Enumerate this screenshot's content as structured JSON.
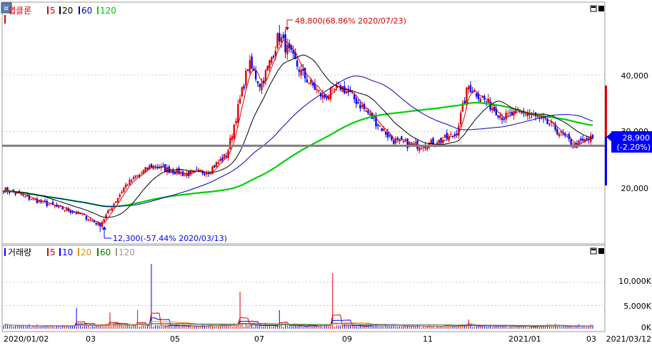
{
  "price_panel": {
    "legend": {
      "name": "앱클론",
      "ma_labels": [
        "5",
        "20",
        "60",
        "120"
      ]
    },
    "high_annotation": "48,800(68.86% 2020/07/23)",
    "low_annotation": "12,300(-57.44% 2020/03/13)",
    "current_price": "28,900",
    "current_change": "(-2.20%)",
    "y_labels": [
      "40,000",
      "30,000",
      "20,000"
    ]
  },
  "volume_panel": {
    "legend": {
      "name": "거래량",
      "ma_labels": [
        "5",
        "10",
        "20",
        "60",
        "120"
      ]
    },
    "y_labels": [
      "10,000K",
      "5,000K",
      "0K"
    ]
  },
  "x_labels": [
    "2020/01/02",
    "03",
    "05",
    "07",
    "09",
    "11",
    "2021/01",
    "03",
    "2021/03/12"
  ],
  "colors": {
    "up": "#e00000",
    "down": "#0000ff",
    "ma5": "#e00000",
    "ma20": "#000000",
    "ma60": "#0000c0",
    "ma120": "#00d000",
    "reference_line": "#808080",
    "grid": "#c8c8c8"
  },
  "chart_data": [
    {
      "type": "candlestick",
      "title": "앱클론",
      "x_range": [
        "2020/01/02",
        "2021/03/12"
      ],
      "ylim": [
        10000,
        50000
      ],
      "y_ticks": [
        20000,
        30000,
        40000
      ],
      "grid": true,
      "keypoints": [
        {
          "date": "2020/01/02",
          "close": 19800
        },
        {
          "date": "2020/02/03",
          "close": 17200
        },
        {
          "date": "2020/02/27",
          "close": 15500
        },
        {
          "date": "2020/03/13",
          "close": 13500,
          "low": 12300
        },
        {
          "date": "2020/04/01",
          "close": 20500
        },
        {
          "date": "2020/04/20",
          "close": 24000
        },
        {
          "date": "2020/05/15",
          "close": 22500
        },
        {
          "date": "2020/06/01",
          "close": 23000
        },
        {
          "date": "2020/06/15",
          "close": 26000
        },
        {
          "date": "2020/06/25",
          "close": 36000
        },
        {
          "date": "2020/07/01",
          "close": 42000
        },
        {
          "date": "2020/07/10",
          "close": 38000
        },
        {
          "date": "2020/07/20",
          "close": 44500
        },
        {
          "date": "2020/07/23",
          "close": 47000,
          "high": 48800
        },
        {
          "date": "2020/08/10",
          "close": 40000
        },
        {
          "date": "2020/08/25",
          "close": 36000
        },
        {
          "date": "2020/09/07",
          "close": 38000
        },
        {
          "date": "2020/09/14",
          "close": 36500
        },
        {
          "date": "2020/09/28",
          "close": 33000
        },
        {
          "date": "2020/10/15",
          "close": 28500
        },
        {
          "date": "2020/10/30",
          "close": 27500
        },
        {
          "date": "2020/11/15",
          "close": 28000
        },
        {
          "date": "2020/12/01",
          "close": 29500
        },
        {
          "date": "2020/12/10",
          "close": 38000
        },
        {
          "date": "2020/12/20",
          "close": 36000
        },
        {
          "date": "2021/01/05",
          "close": 32500
        },
        {
          "date": "2021/01/20",
          "close": 33500
        },
        {
          "date": "2021/02/10",
          "close": 31000
        },
        {
          "date": "2021/02/26",
          "close": 27500
        },
        {
          "date": "2021/03/12",
          "close": 28900
        }
      ],
      "series": [
        {
          "name": "5"
        },
        {
          "name": "20"
        },
        {
          "name": "60"
        },
        {
          "name": "120"
        }
      ],
      "reference_line": 27500,
      "last": {
        "price": 28900,
        "change_pct": -2.2
      }
    },
    {
      "type": "bar",
      "title": "거래량",
      "unit": "K",
      "ylim": [
        0,
        15000
      ],
      "y_ticks": [
        0,
        5000,
        10000
      ],
      "spikes": [
        {
          "date": "2020/02/25",
          "value": 4500
        },
        {
          "date": "2020/03/20",
          "value": 3500
        },
        {
          "date": "2020/04/10",
          "value": 4000
        },
        {
          "date": "2020/04/20",
          "value": 14000
        },
        {
          "date": "2020/06/25",
          "value": 8000
        },
        {
          "date": "2020/07/23",
          "value": 4000
        },
        {
          "date": "2020/09/01",
          "value": 12000
        },
        {
          "date": "2020/12/10",
          "value": 2000
        }
      ],
      "series": [
        {
          "name": "5"
        },
        {
          "name": "10"
        },
        {
          "name": "20"
        },
        {
          "name": "60"
        },
        {
          "name": "120"
        }
      ]
    }
  ]
}
